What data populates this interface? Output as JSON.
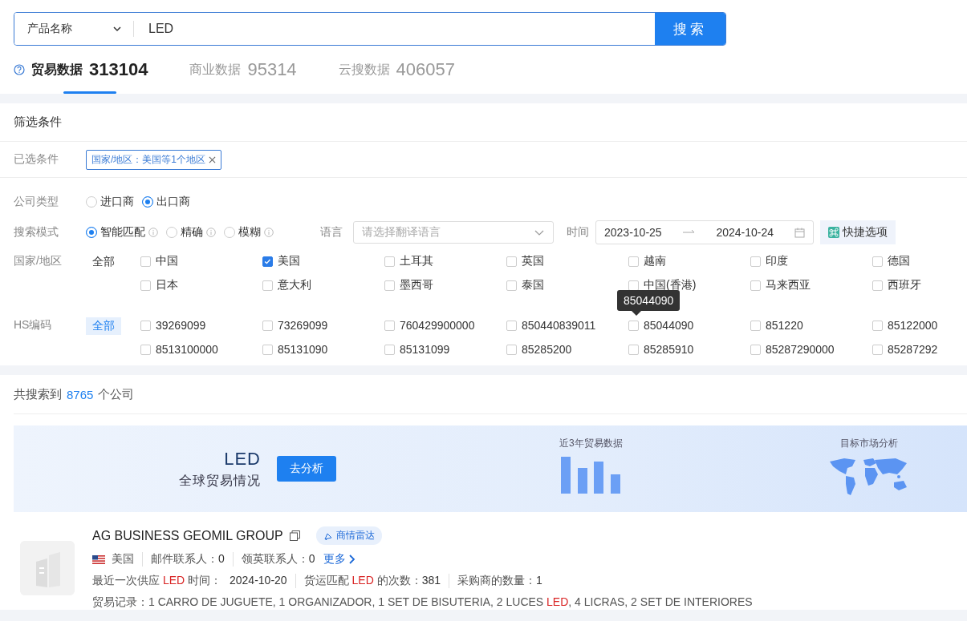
{
  "search": {
    "field_select": "产品名称",
    "query": "LED",
    "button": "搜索"
  },
  "data_tabs": [
    {
      "label": "贸易数据",
      "count": "313104",
      "selected": true
    },
    {
      "label": "商业数据",
      "count": "95314",
      "selected": false
    },
    {
      "label": "云搜数据",
      "count": "406057",
      "selected": false
    }
  ],
  "filters": {
    "title": "筛选条件",
    "selected_label": "已选条件",
    "selected_tags": [
      "国家/地区：美国等1个地区"
    ],
    "company_type": {
      "label": "公司类型",
      "options": [
        {
          "label": "进口商",
          "selected": false
        },
        {
          "label": "出口商",
          "selected": true
        }
      ]
    },
    "search_mode": {
      "label": "搜索模式",
      "options": [
        {
          "label": "智能匹配",
          "selected": true
        },
        {
          "label": "精确",
          "selected": false
        },
        {
          "label": "模糊",
          "selected": false
        }
      ]
    },
    "language": {
      "label": "语言",
      "placeholder": "请选择翻译语言"
    },
    "time": {
      "label": "时间",
      "start": "2023-10-25",
      "end": "2024-10-24"
    },
    "quick_options": "快捷选项",
    "countries": {
      "label": "国家/地区",
      "all": {
        "label": "全部",
        "selected": false
      },
      "options": [
        {
          "label": "中国",
          "checked": false
        },
        {
          "label": "美国",
          "checked": true
        },
        {
          "label": "土耳其",
          "checked": false
        },
        {
          "label": "英国",
          "checked": false
        },
        {
          "label": "越南",
          "checked": false
        },
        {
          "label": "印度",
          "checked": false
        },
        {
          "label": "德国",
          "checked": false
        },
        {
          "label": "日本",
          "checked": false
        },
        {
          "label": "意大利",
          "checked": false
        },
        {
          "label": "墨西哥",
          "checked": false
        },
        {
          "label": "泰国",
          "checked": false
        },
        {
          "label": "中国(香港)",
          "checked": false
        },
        {
          "label": "马来西亚",
          "checked": false
        },
        {
          "label": "西班牙",
          "checked": false
        }
      ]
    },
    "hs_codes": {
      "label": "HS编码",
      "all": {
        "label": "全部",
        "selected": true
      },
      "tooltip": "85044090",
      "options": [
        {
          "label": "39269099",
          "checked": false
        },
        {
          "label": "73269099",
          "checked": false
        },
        {
          "label": "760429900000",
          "checked": false
        },
        {
          "label": "850440839011",
          "checked": false
        },
        {
          "label": "85044090",
          "checked": false
        },
        {
          "label": "851220",
          "checked": false
        },
        {
          "label": "85122000",
          "checked": false
        },
        {
          "label": "8513100000",
          "checked": false
        },
        {
          "label": "85131090",
          "checked": false
        },
        {
          "label": "85131099",
          "checked": false
        },
        {
          "label": "85285200",
          "checked": false
        },
        {
          "label": "85285910",
          "checked": false
        },
        {
          "label": "85287290000",
          "checked": false
        },
        {
          "label": "85287292",
          "checked": false
        }
      ]
    }
  },
  "results": {
    "prefix": "共搜索到",
    "count": "8765",
    "suffix": "个公司"
  },
  "banner": {
    "keyword": "LED",
    "subtitle": "全球贸易情况",
    "button": "去分析",
    "trade_label": "近3年贸易数据",
    "market_label": "目标市场分析"
  },
  "companies": [
    {
      "name": "AG BUSINESS GEOMIL GROUP",
      "radar_tag": "商情雷达",
      "country": "美国",
      "email_label": "邮件联系人：",
      "email_count": "0",
      "linkedin_label": "领英联系人：",
      "linkedin_count": "0",
      "more": "更多",
      "last_supply": [
        {
          "text": "最近一次供应 ",
          "highlight": false
        },
        {
          "text": "LED",
          "highlight": true
        },
        {
          "text": " 时间：",
          "highlight": false
        }
      ],
      "last_supply_date": "2024-10-20",
      "shipments": [
        {
          "text": "货运匹配 ",
          "highlight": false
        },
        {
          "text": "LED",
          "highlight": true
        },
        {
          "text": " 的次数：",
          "highlight": false
        }
      ],
      "shipments_count": "381",
      "buyers_label": "采购商的数量：",
      "buyers_count": "1",
      "trade_records": [
        {
          "text": "贸易记录：1 CARRO DE JUGUETE, 1 ORGANIZADOR, 1 SET DE BISUTERIA, 2 LUCES ",
          "highlight": false
        },
        {
          "text": "LED",
          "highlight": true
        },
        {
          "text": ", 4 LICRAS, 2 SET DE INTERIORES",
          "highlight": false
        }
      ]
    }
  ]
}
